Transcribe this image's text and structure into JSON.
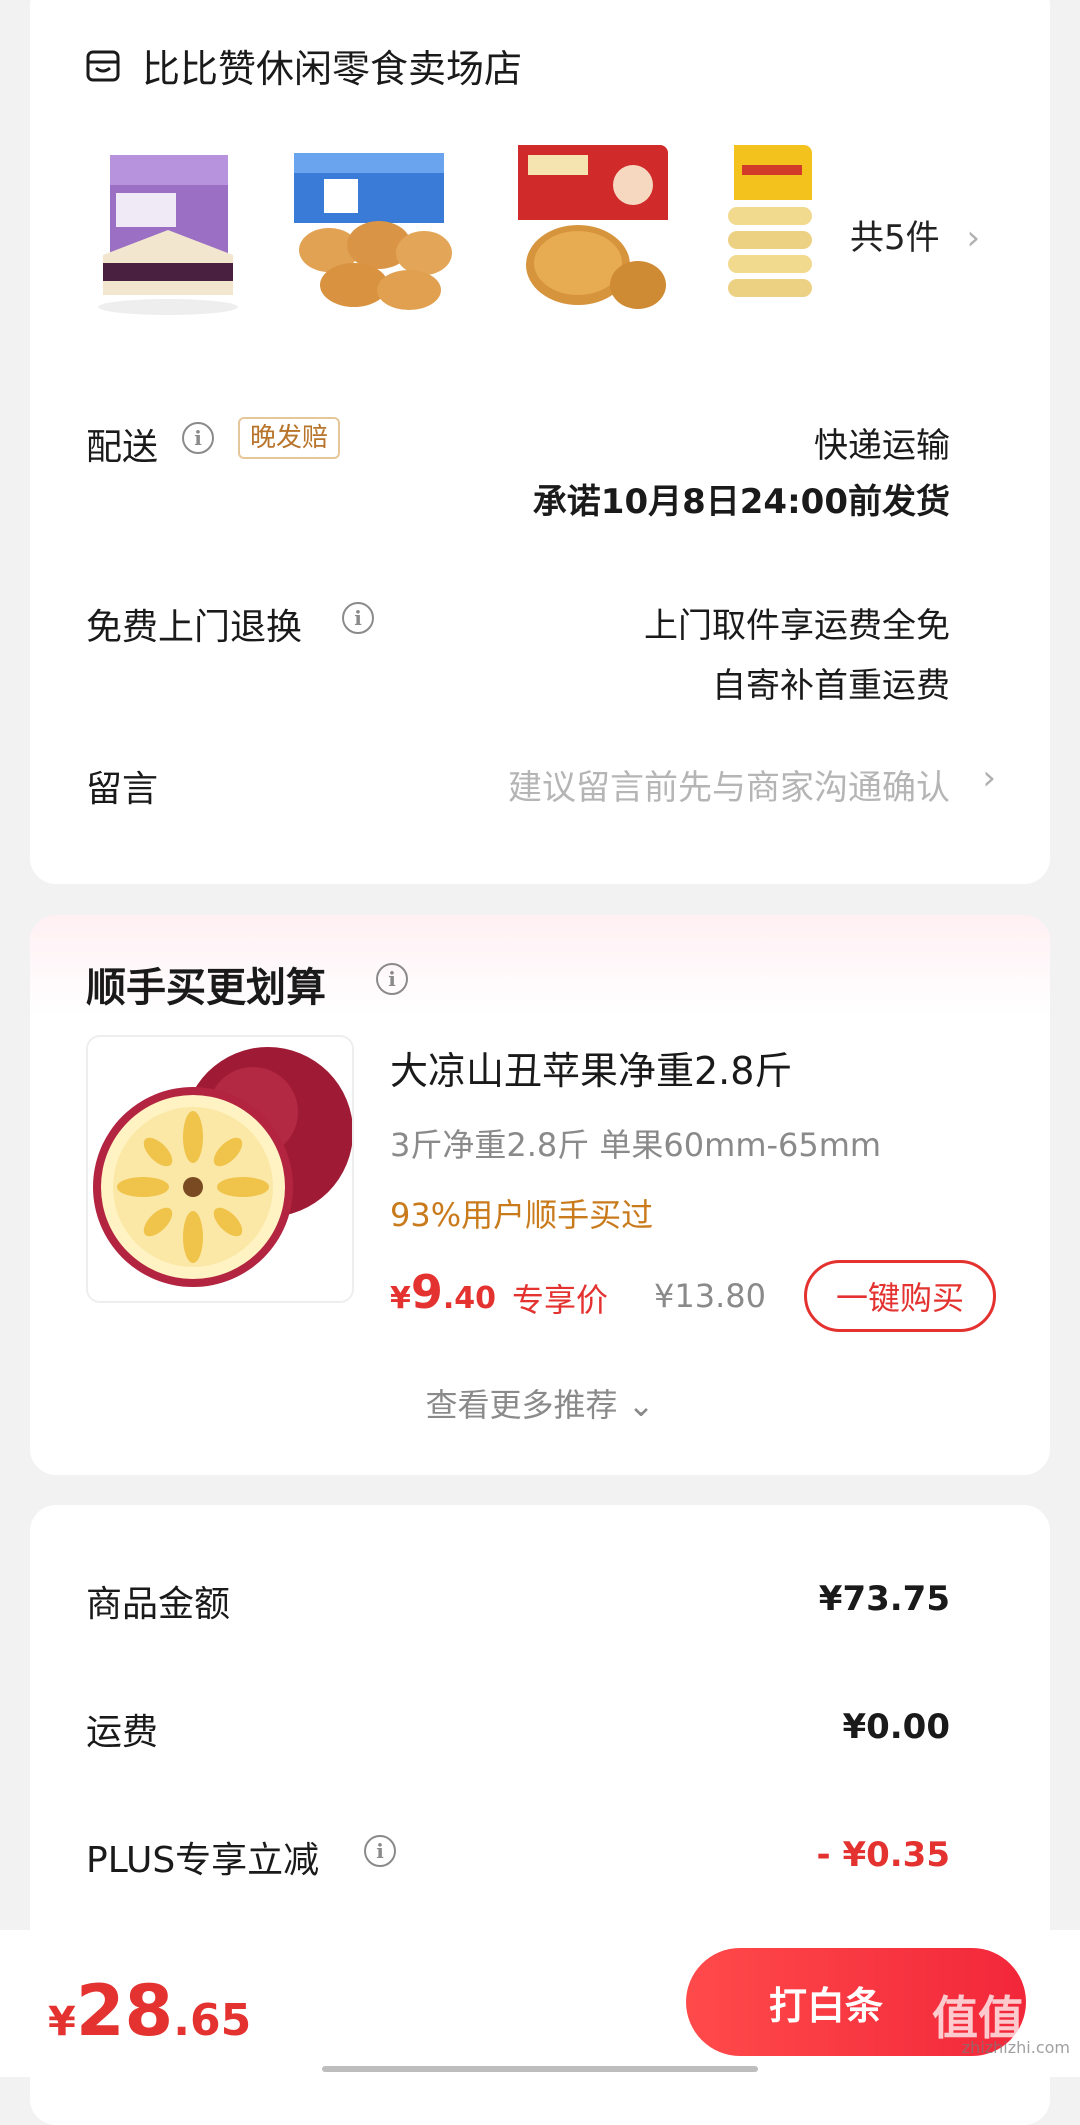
{
  "shop": {
    "icon": "store-icon",
    "name": "比比赞休闲零食卖场店",
    "item_count": "共5件",
    "chevron": "›",
    "thumbnails": [
      "product-thumb-1",
      "product-thumb-2",
      "product-thumb-3",
      "product-thumb-4"
    ]
  },
  "delivery": {
    "label": "配送",
    "badge": "晚发赔",
    "method": "快递运输",
    "promise": "承诺10月8日24:00前发货"
  },
  "returns": {
    "label": "免费上门退换",
    "line1": "上门取件享运费全免",
    "line2": "自寄补首重运费"
  },
  "message": {
    "label": "留言",
    "placeholder": "建议留言前先与商家沟通确认",
    "chevron": "›"
  },
  "recommend": {
    "title": "顺手买更划算",
    "product": {
      "name": "大凉山丑苹果净重2.8斤",
      "spec": "3斤净重2.8斤   单果60mm-65mm",
      "popularity": "93%用户顺手买过",
      "price_currency": "¥",
      "price_int": "9",
      "price_dec": ".40",
      "price_tag": "专享价",
      "original_price": "¥13.80",
      "buy_label": "一键购买"
    },
    "more": "查看更多推荐 ⌄"
  },
  "amounts": {
    "items": [
      {
        "label": "商品金额",
        "value": "¥73.75"
      },
      {
        "label": "运费",
        "value": "¥0.00"
      },
      {
        "label": "PLUS专享立减",
        "value": "- ¥0.35"
      }
    ]
  },
  "footer": {
    "total_currency": "¥",
    "total_int": "28",
    "total_dec": ".65",
    "pay_label": "打白条",
    "watermark": "值值值",
    "watermark_url": "zhizhizhi.com"
  },
  "colors": {
    "accent_red": "#e3322f",
    "popularity_orange": "#c97b1c",
    "badge_brown": "#b8742b"
  }
}
